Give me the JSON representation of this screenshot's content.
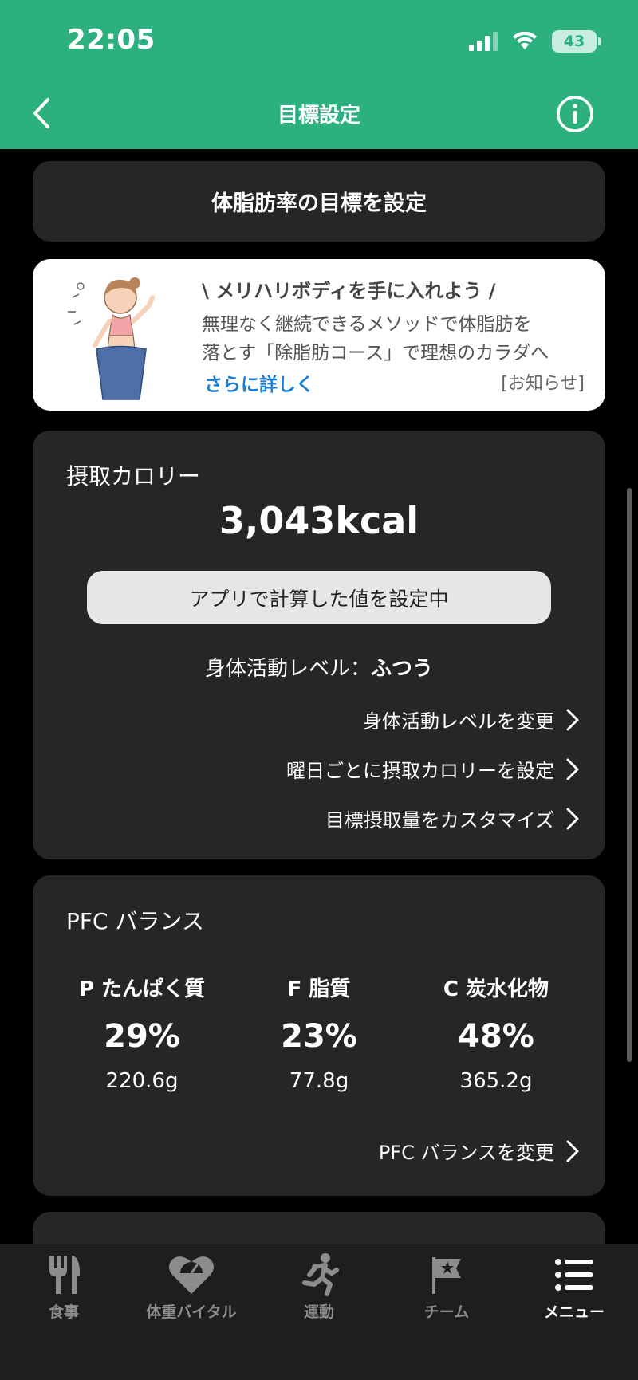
{
  "status_bar": {
    "time": "22:05",
    "battery": "43"
  },
  "nav": {
    "title": "目標設定"
  },
  "goal_button": {
    "label": "体脂肪率の目標を設定"
  },
  "promo": {
    "title": "\\ メリハリボディを手に入れよう /",
    "line1": "無理なく継続できるメソッドで体脂肪を",
    "line2": "落とす「除脂肪コース」で理想のカラダへ",
    "link": "さらに詳しく",
    "tag": "[お知らせ]"
  },
  "calories": {
    "label": "摂取カロリー",
    "value": "3,043kcal",
    "calc_label": "アプリで計算した値を設定中",
    "activity_prefix": "身体活動レベル：",
    "activity_value": "ふつう",
    "links": [
      "身体活動レベルを変更",
      "曜日ごとに摂取カロリーを設定",
      "目標摂取量をカスタマイズ"
    ]
  },
  "pfc": {
    "label": "PFC バランス",
    "items": [
      {
        "name": "P たんぱく質",
        "pct": "29%",
        "grams": "220.6g"
      },
      {
        "name": "F 脂質",
        "pct": "23%",
        "grams": "77.8g"
      },
      {
        "name": "C 炭水化物",
        "pct": "48%",
        "grams": "365.2g"
      }
    ],
    "change_link": "PFC バランスを変更"
  },
  "tabs": [
    {
      "label": "食事",
      "icon": "fork-knife-icon"
    },
    {
      "label": "体重バイタル",
      "icon": "heart-scale-icon"
    },
    {
      "label": "運動",
      "icon": "runner-icon"
    },
    {
      "label": "チーム",
      "icon": "flag-star-icon"
    },
    {
      "label": "メニュー",
      "icon": "menu-list-icon",
      "active": true
    }
  ],
  "colors": {
    "header": "#2cb07f",
    "link": "#1b7fd6",
    "card": "#262626"
  }
}
